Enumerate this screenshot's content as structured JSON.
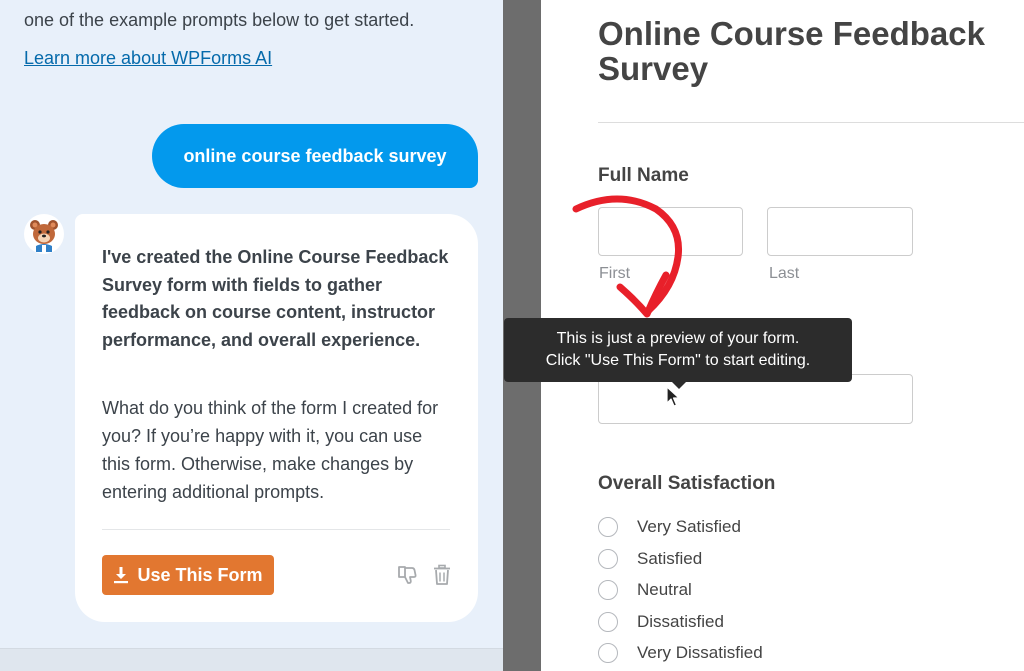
{
  "chat": {
    "intro_text": "one of the example prompts below to get started.",
    "learn_more_link": "Learn more about WPForms AI",
    "user_message": "online course feedback survey",
    "ai_response_bold": "I've created the Online Course Feedback Survey form with fields to gather feedback on course content, instructor performance, and overall experience.",
    "ai_response_text": "What do you think of the form I created for you? If you’re happy with it, you can use this form. Otherwise, make changes by entering additional prompts.",
    "use_form_button": "Use This Form",
    "icons": {
      "avatar": "wpforms-bear-mascot",
      "download": "download-icon",
      "dislike": "thumbs-down-icon",
      "delete": "trash-icon"
    },
    "colors": {
      "panel_bg": "#e8f0fa",
      "user_bubble": "#0399ed",
      "use_form_button": "#e27730",
      "link": "#056aab"
    }
  },
  "preview": {
    "form_title": "Online Course Feedback Survey",
    "full_name_label": "Full Name",
    "first_sublabel": "First",
    "last_sublabel": "Last",
    "satisfaction_label": "Overall Satisfaction",
    "satisfaction_options": [
      "Very Satisfied",
      "Satisfied",
      "Neutral",
      "Dissatisfied",
      "Very Dissatisfied"
    ],
    "tooltip_line1": "This is just a preview of your form.",
    "tooltip_line2": "Click \"Use This Form\" to start editing.",
    "colors": {
      "annotation_arrow": "#e8202a",
      "tooltip_bg": "#2c2c2c"
    }
  }
}
